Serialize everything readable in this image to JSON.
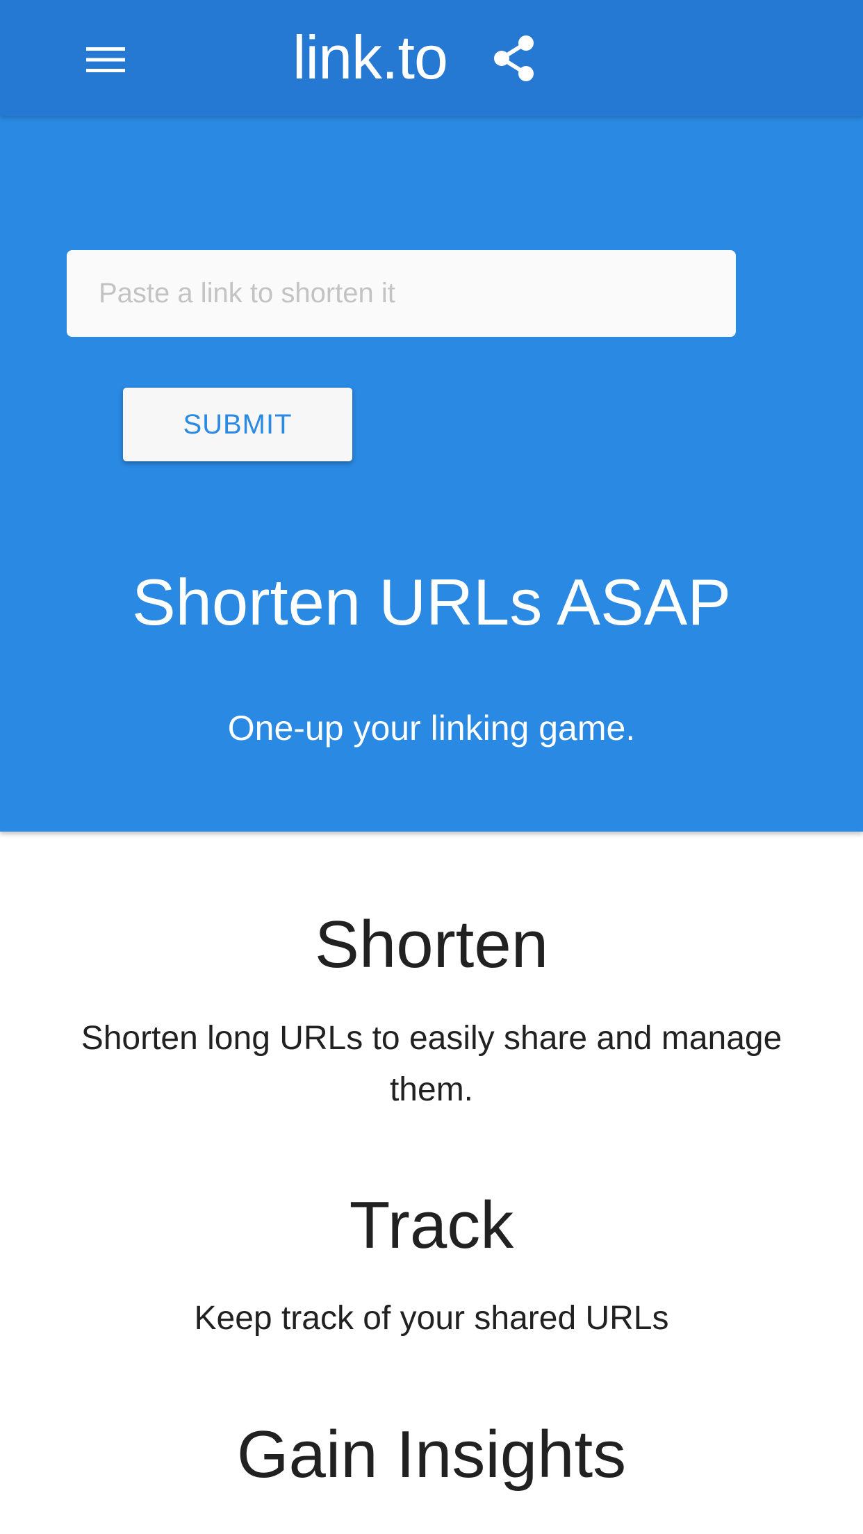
{
  "app_bar": {
    "title": "link.to",
    "menu_icon": "menu-icon",
    "share_icon": "share-icon",
    "color": "#2579d2"
  },
  "hero": {
    "input_placeholder": "Paste a link to shorten it",
    "input_value": "",
    "submit_label": "SUBMIT",
    "title": "Shorten URLs ASAP",
    "subtitle": "One-up your linking game.",
    "color": "#2a89e2"
  },
  "features": [
    {
      "heading": "Shorten",
      "text": "Shorten long URLs to easily share and manage them."
    },
    {
      "heading": "Track",
      "text": "Keep track of your shared URLs"
    },
    {
      "heading": "Gain Insights",
      "text": ""
    }
  ]
}
